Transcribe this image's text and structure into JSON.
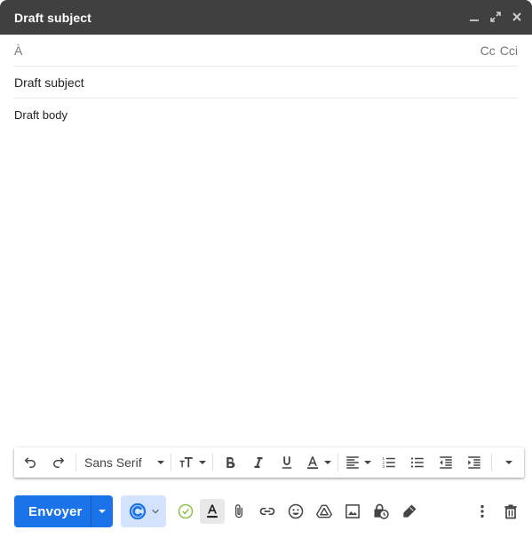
{
  "window": {
    "title": "Draft subject",
    "actions": [
      {
        "name": "minimize",
        "icon": "minimize-icon"
      },
      {
        "name": "fullscreen",
        "icon": "expand-icon"
      },
      {
        "name": "close",
        "icon": "close-icon"
      }
    ]
  },
  "recipients": {
    "to_label": "À",
    "to_value": "",
    "cc_label": "Cc",
    "bcc_label": "Cci"
  },
  "subject": {
    "value": "Draft subject"
  },
  "body": {
    "text": "Draft body"
  },
  "formatting_toolbar": {
    "font_family": "Sans Serif",
    "buttons": [
      {
        "name": "undo",
        "icon": "undo-icon"
      },
      {
        "name": "redo",
        "icon": "redo-icon"
      },
      {
        "name": "font-size",
        "icon": "font-size-icon"
      },
      {
        "name": "bold",
        "icon": "bold-icon"
      },
      {
        "name": "italic",
        "icon": "italic-icon"
      },
      {
        "name": "underline",
        "icon": "underline-icon"
      },
      {
        "name": "text-color",
        "icon": "text-color-icon"
      },
      {
        "name": "align",
        "icon": "align-left-icon"
      },
      {
        "name": "numbered-list",
        "icon": "numbered-list-icon"
      },
      {
        "name": "bulleted-list",
        "icon": "bulleted-list-icon"
      },
      {
        "name": "indent-less",
        "icon": "indent-less-icon"
      },
      {
        "name": "indent-more",
        "icon": "indent-more-icon"
      },
      {
        "name": "more-formatting",
        "icon": "chevron-down-icon"
      }
    ]
  },
  "bottom_toolbar": {
    "send_label": "Envoyer",
    "buttons": [
      {
        "name": "extension",
        "icon": "extension-c-icon"
      },
      {
        "name": "check",
        "icon": "check-circle-icon"
      },
      {
        "name": "formatting-options",
        "icon": "text-format-icon"
      },
      {
        "name": "attach-file",
        "icon": "paperclip-icon"
      },
      {
        "name": "insert-link",
        "icon": "link-icon"
      },
      {
        "name": "insert-emoji",
        "icon": "emoji-icon"
      },
      {
        "name": "insert-drive",
        "icon": "drive-icon"
      },
      {
        "name": "insert-photo",
        "icon": "image-icon"
      },
      {
        "name": "confidential-mode",
        "icon": "lock-clock-icon"
      },
      {
        "name": "insert-signature",
        "icon": "pen-icon"
      },
      {
        "name": "more-options",
        "icon": "more-vert-icon"
      },
      {
        "name": "discard-draft",
        "icon": "trash-icon"
      }
    ]
  },
  "colors": {
    "header_bg": "#404040",
    "send_blue": "#1a73e8",
    "extension_bg": "#d3e3fd",
    "check_green": "#8bc34a"
  }
}
